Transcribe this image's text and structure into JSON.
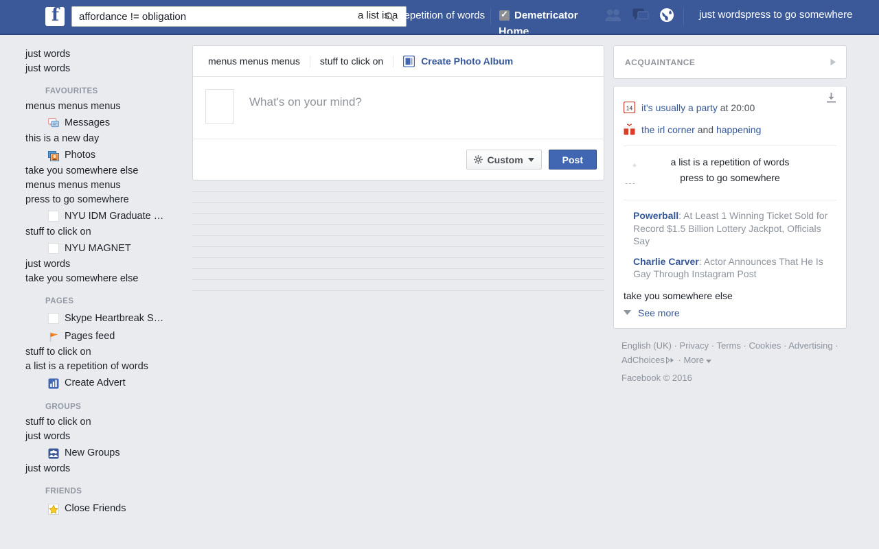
{
  "header": {
    "logo_letter": "f",
    "search_value": "affordance != obligation",
    "search_placeholder": "Search",
    "headline_prefix": "a list is a",
    "headline_suffix": "repetition of words",
    "demetricator_label": "Demetricator",
    "home_label": "Home",
    "right_text": "just wordspress to go somewhere",
    "icons": [
      "friends-icon",
      "messages-icon",
      "globe-icon"
    ],
    "colors": {
      "bar": "#3b5998",
      "bar_border": "#29447e",
      "accent": "#4267b2"
    }
  },
  "sidebar": {
    "top_items": [
      {
        "label": "just words",
        "icon": null
      },
      {
        "label": "just words",
        "icon": null
      }
    ],
    "sections": [
      {
        "heading": "FAVOURITES",
        "items": [
          {
            "label": "menus menus menus",
            "icon": null
          },
          {
            "label": "Messages",
            "icon": "messages-icon"
          },
          {
            "label": "this is a new day",
            "icon": null
          },
          {
            "label": "Photos",
            "icon": "photos-icon"
          },
          {
            "label": "take you somewhere else",
            "icon": null
          },
          {
            "label": "menus menus menus",
            "icon": null
          },
          {
            "label": "press to go somewhere",
            "icon": null
          },
          {
            "label": "NYU IDM Graduate …",
            "icon": "blank-icon"
          },
          {
            "label": "stuff to click on",
            "icon": null
          },
          {
            "label": "NYU MAGNET",
            "icon": "blank-icon"
          },
          {
            "label": "just words",
            "icon": null
          },
          {
            "label": "take you somewhere else",
            "icon": null
          }
        ]
      },
      {
        "heading": "PAGES",
        "items": [
          {
            "label": "Skype Heartbreak S…",
            "icon": "blank-icon"
          },
          {
            "label": "Pages feed",
            "icon": "flag-icon"
          },
          {
            "label": "stuff to click on",
            "icon": null
          },
          {
            "label": "a list is a repetition of words",
            "icon": null
          },
          {
            "label": "Create Advert",
            "icon": "chart-icon"
          }
        ]
      },
      {
        "heading": "GROUPS",
        "items": [
          {
            "label": "stuff to click on",
            "icon": null
          },
          {
            "label": "just words",
            "icon": null
          },
          {
            "label": "New Groups",
            "icon": "groups-icon"
          },
          {
            "label": "just words",
            "icon": null
          }
        ]
      },
      {
        "heading": "FRIENDS",
        "items": [
          {
            "label": "Close Friends",
            "icon": "star-icon"
          }
        ]
      }
    ]
  },
  "composer": {
    "tab_1": "menus menus menus",
    "tab_2": "stuff to click on",
    "photo_album_label": "Create Photo Album",
    "placeholder": "What's on your mind?",
    "audience_label": "Custom",
    "post_label": "Post"
  },
  "feed": {
    "line_count": 10
  },
  "right": {
    "acquaintance_label": "ACQUAINTANCE",
    "ticker": {
      "event_day": "14",
      "event_link": "it's usually a party",
      "event_suffix": "at 20:00",
      "gift_link": "the irl corner",
      "gift_mid": "and",
      "gift_link2": "happening",
      "center_line_1": "a list is a repetition of words",
      "center_line_2": "press to go somewhere",
      "dashes": "---"
    },
    "news": [
      {
        "source": "Powerball",
        "text": ": At Least 1 Winning Ticket Sold for Record $1.5 Billion Lottery Jackpot, Officials Say"
      },
      {
        "source": "Charlie Carver",
        "text": ": Actor Announces That He Is Gay Through Instagram Post"
      }
    ],
    "footer_text": "take you somewhere else",
    "see_more_label": "See more"
  },
  "footer": {
    "links": [
      "English (UK)",
      "Privacy",
      "Terms",
      "Cookies",
      "Advertising",
      "AdChoices",
      "More"
    ],
    "copyright": "Facebook © 2016"
  }
}
